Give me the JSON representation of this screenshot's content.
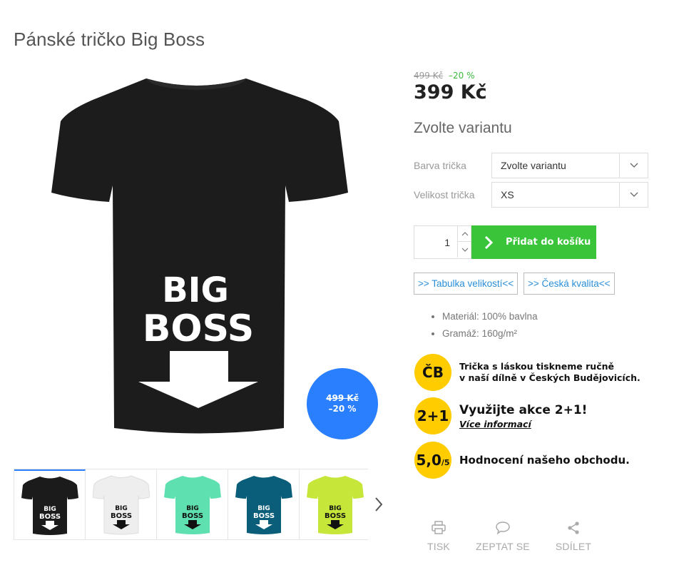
{
  "product": {
    "title": "Pánské tričko Big Boss",
    "print_line1": "BIG",
    "print_line2": "BOSS",
    "price_old": "499 Kč",
    "price_discount": "–20 %",
    "price_current": "399 Kč",
    "badge_old": "499 Kč",
    "badge_discount": "–20 %"
  },
  "thumbnails": [
    {
      "color": "#1b1b1b",
      "print_color": "#ffffff",
      "line1": "BIG",
      "line2": "BOSS"
    },
    {
      "color": "#eeeeee",
      "print_color": "#111111",
      "line1": "BIG",
      "line2": "BOSS"
    },
    {
      "color": "#5fe0b0",
      "print_color": "#111111",
      "line1": "BIG",
      "line2": "BOSS"
    },
    {
      "color": "#0a5e7a",
      "print_color": "#ffffff",
      "line1": "BIG",
      "line2": "BOSS"
    },
    {
      "color": "#c6e63a",
      "print_color": "#111111",
      "line1": "BIG",
      "line2": "BOSS"
    }
  ],
  "variants": {
    "heading": "Zvolte variantu",
    "color_label": "Barva trička",
    "color_value": "Zvolte variantu",
    "size_label": "Velikost trička",
    "size_value": "XS"
  },
  "cart": {
    "quantity": "1",
    "add_label": "Přidat do košíku"
  },
  "links": {
    "size_table": ">> Tabulka velikostí<<",
    "czech_quality": ">> Česká kvalita<<"
  },
  "features": [
    "Materiál: 100% bavlna",
    "Gramáž: 160g/m²"
  ],
  "promos": {
    "cb_badge": "ČB",
    "cb_line1": "Trička s láskou tiskneme ručně",
    "cb_line2": "v naší dílně v Českých Budějovicích.",
    "deal_badge": "2+1",
    "deal_title": "Využijte akce 2+1!",
    "deal_link": "Více informací",
    "rating_badge": "5,0",
    "rating_suffix": "/5",
    "rating_text": "Hodnocení našeho obchodu."
  },
  "actions": {
    "print": "TISK",
    "ask": "ZEPTAT SE",
    "share": "SDÍLET"
  },
  "colors": {
    "accent_blue": "#2a7fff",
    "add_green": "#3ac43a",
    "discount_green": "#3db83d",
    "promo_yellow": "#ffcc00",
    "link_blue": "#2a8fd8"
  }
}
